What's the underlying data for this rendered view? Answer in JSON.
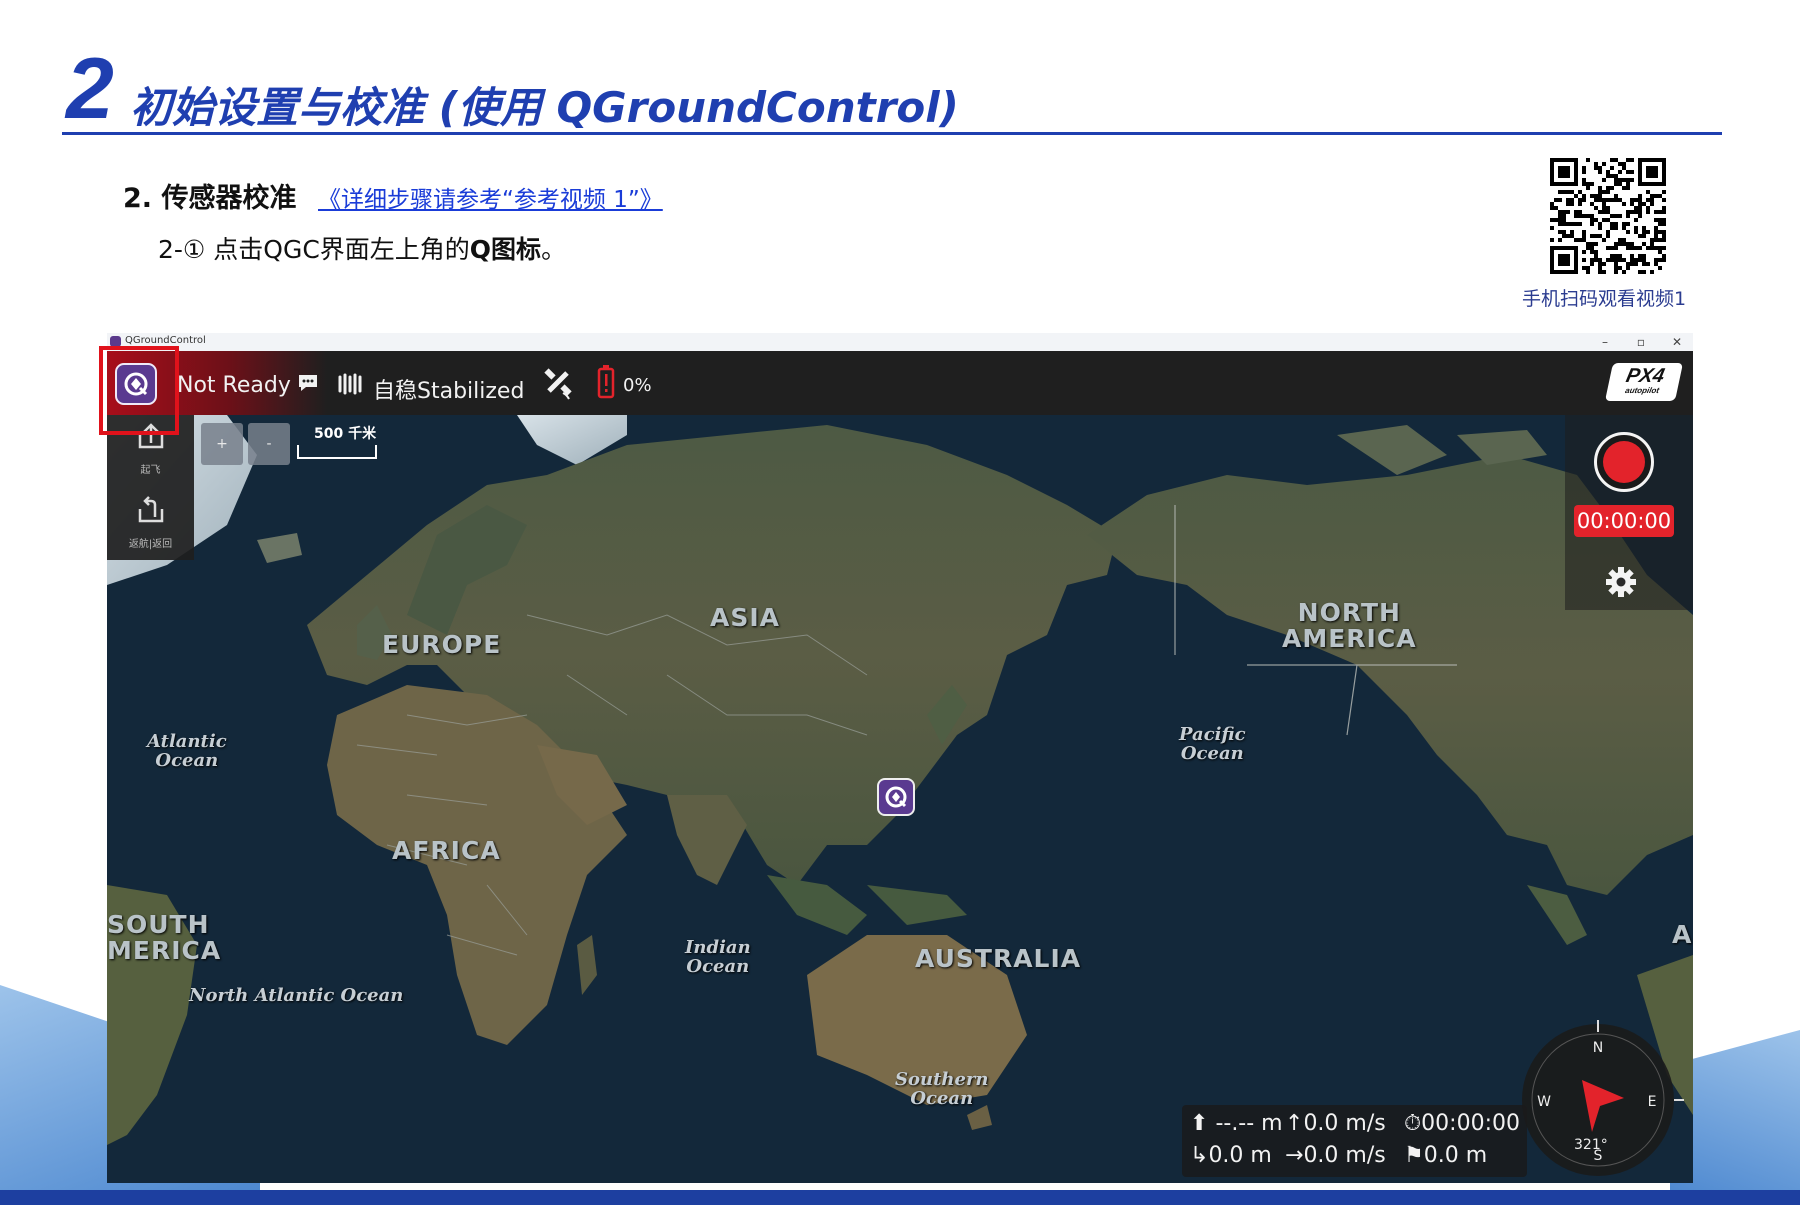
{
  "slide": {
    "number": "2",
    "title": "初始设置与校准 (使用 QGroundControl)",
    "step_heading": "2. 传感器校准",
    "step_link": "《详细步骤请参考“参考视频 1”》",
    "step_text_prefix": "2-① 点击QGC界面左上角的",
    "step_text_bold": "Q图标",
    "step_text_suffix": "。",
    "qr_caption": "手机扫码观看视频1"
  },
  "window": {
    "title": "QGroundControl",
    "minimize": "–",
    "maximize": "▫",
    "close": "✕"
  },
  "toolbar": {
    "status": "Not Ready",
    "flight_mode": "自稳Stabilized",
    "battery": "0%",
    "brand_logo": "PX4",
    "brand_sub": "autopilot"
  },
  "map": {
    "zoom_in": "+",
    "zoom_out": "-",
    "scale": "500 千米",
    "labels": {
      "asia": "ASIA",
      "europe": "EUROPE",
      "africa": "AFRICA",
      "north_america": "NORTH\nAMERICA",
      "south_america": "SOUTH\nMERICA",
      "australia": "AUSTRALIA",
      "edge_a": "A"
    },
    "oceans": {
      "atlantic": "Atlantic\nOcean",
      "pacific": "Pacific\nOcean",
      "indian": "Indian\nOcean",
      "north_atlantic": "North Atlantic Ocean",
      "southern": "Southern\nOcean"
    }
  },
  "side_panel": {
    "takeoff": "起飞",
    "return": "返航|返回"
  },
  "recording": {
    "time": "00:00:00"
  },
  "telemetry": {
    "altitude": "--.-- m",
    "vertical_speed": "0.0 m/s",
    "flight_time": "00:00:00",
    "distance": "0.0 m",
    "horizontal_speed": "0.0 m/s",
    "home_distance": "0.0 m"
  },
  "compass": {
    "n": "N",
    "e": "E",
    "s": "S",
    "w": "W",
    "heading": "321°"
  },
  "colors": {
    "title_blue": "#1f3fb0",
    "link_blue": "#1a3cd8",
    "qgc_purple": "#5a3a90",
    "alert_red": "#e3232b",
    "highlight_red": "#e0121b"
  }
}
